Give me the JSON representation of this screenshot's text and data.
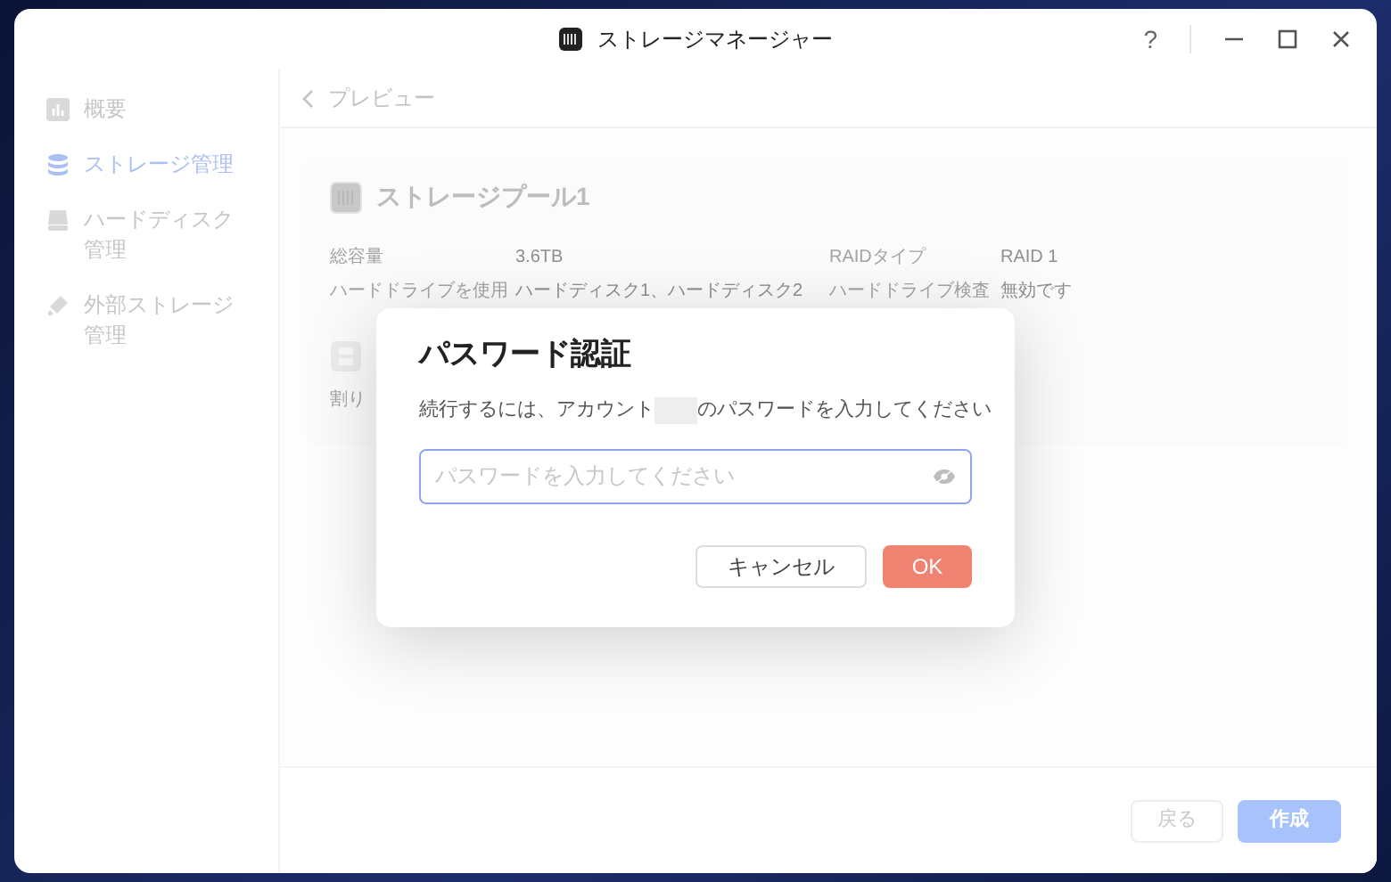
{
  "window": {
    "title": "ストレージマネージャー",
    "help_label": "?"
  },
  "sidebar": {
    "items": [
      {
        "label": "概要",
        "selected": false
      },
      {
        "label": "ストレージ管理",
        "selected": true
      },
      {
        "label": "ハードディスク管理",
        "selected": false
      },
      {
        "label": "外部ストレージ管理",
        "selected": false
      }
    ]
  },
  "header": {
    "back_label": "プレビュー"
  },
  "pool": {
    "title": "ストレージプール1",
    "fields": [
      {
        "label": "総容量",
        "value": "3.6TB"
      },
      {
        "label": "RAIDタイプ",
        "value": "RAID 1"
      },
      {
        "label": "ハードドライブを使用",
        "value": "ハードディスク1、ハードディスク2"
      },
      {
        "label": "ハードドライブ検査",
        "value": "無効です"
      }
    ],
    "section_label": "割り"
  },
  "dialog": {
    "title": "パスワード認証",
    "message_parts": [
      "続行するには、アカウント",
      "のパスワードを入力してください"
    ],
    "password": {
      "placeholder": "パスワードを入力してください"
    },
    "buttons": [
      {
        "label": "キャンセル",
        "kind": "secondary"
      },
      {
        "label": "OK",
        "kind": "primary"
      }
    ]
  },
  "footer": {
    "buttons": [
      {
        "label": "戻る",
        "kind": "secondary",
        "disabled": true
      },
      {
        "label": "作成",
        "kind": "primary",
        "disabled": true
      }
    ]
  }
}
